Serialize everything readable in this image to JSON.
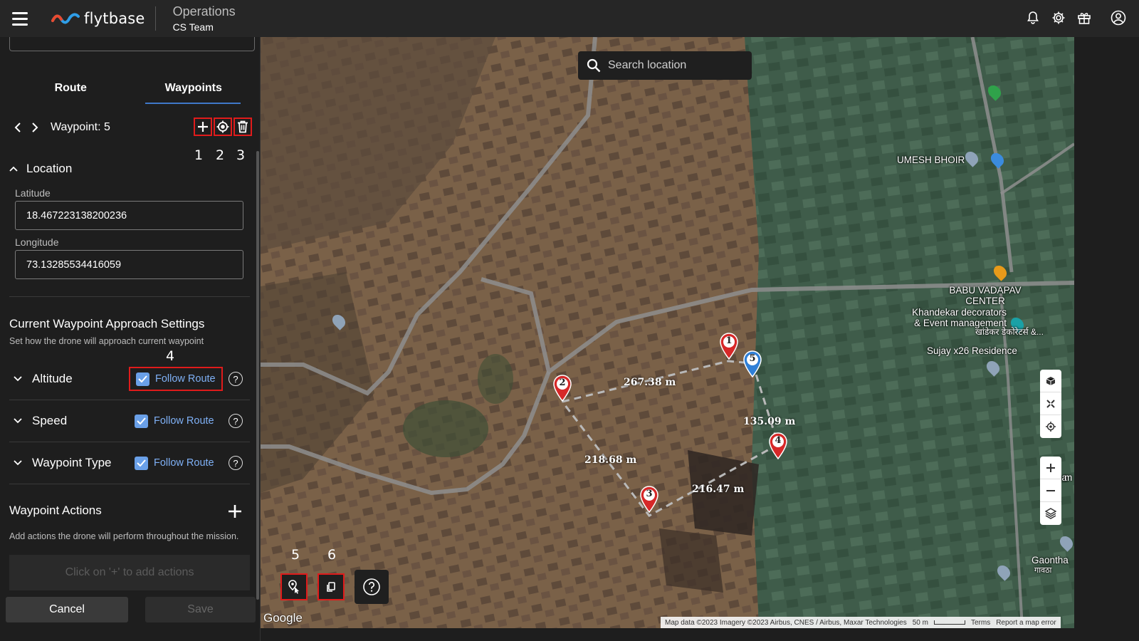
{
  "app": {
    "brand": "flytbase",
    "section_title": "Operations",
    "team": "CS Team",
    "icons": [
      "bell-icon",
      "gear-icon",
      "gift-icon",
      "user-circle-icon"
    ]
  },
  "tabs": [
    {
      "label": "Route",
      "active": false
    },
    {
      "label": "Waypoints",
      "active": true
    }
  ],
  "waypoint": {
    "label": "Waypoint: 5",
    "tool_numbers": [
      "1",
      "2",
      "3"
    ]
  },
  "location": {
    "title": "Location",
    "latitude_label": "Latitude",
    "latitude_value": "18.467223138200236",
    "longitude_label": "Longitude",
    "longitude_value": "73.13285534416059"
  },
  "approach": {
    "title": "Current Waypoint Approach Settings",
    "subtitle": "Set how the drone will approach current waypoint",
    "marker_number": "4",
    "settings": [
      {
        "name": "Altitude",
        "follow_label": "Follow Route",
        "checked": true
      },
      {
        "name": "Speed",
        "follow_label": "Follow Route",
        "checked": true
      },
      {
        "name": "Waypoint Type",
        "follow_label": "Follow Route",
        "checked": true
      }
    ]
  },
  "actions": {
    "title": "Waypoint Actions",
    "subtitle": "Add actions the drone will perform throughout the mission.",
    "placeholder": "Click on '+' to add actions"
  },
  "buttons": {
    "cancel": "Cancel",
    "save": "Save"
  },
  "map": {
    "search_placeholder": "Search location",
    "waypoints": [
      "1",
      "2",
      "3",
      "4",
      "5"
    ],
    "distances": [
      "267.38 m",
      "135.09 m",
      "218.68 m",
      "216.47 m"
    ],
    "pois": [
      "UMESH BHOIR",
      "BABU VADAPAV CENTER",
      "Khandekar decorators & Event management",
      "खांडेकर डेकोरेटर्स &...",
      "Sujay x26 Residence",
      "Bha",
      "m",
      "Gaontha",
      "गावठा"
    ],
    "tool_numbers": [
      "5",
      "6"
    ],
    "google_label": "Google",
    "attribution": "Map data ©2023 Imagery ©2023 Airbus, CNES / Airbus, Maxar Technologies",
    "scale": "50 m",
    "terms": "Terms",
    "report": "Report a map error",
    "colors": {
      "marker_red": "#d62828",
      "marker_blue": "#2f7fd6",
      "highlight": "#e01b1b",
      "accent": "#3f78c8"
    }
  }
}
